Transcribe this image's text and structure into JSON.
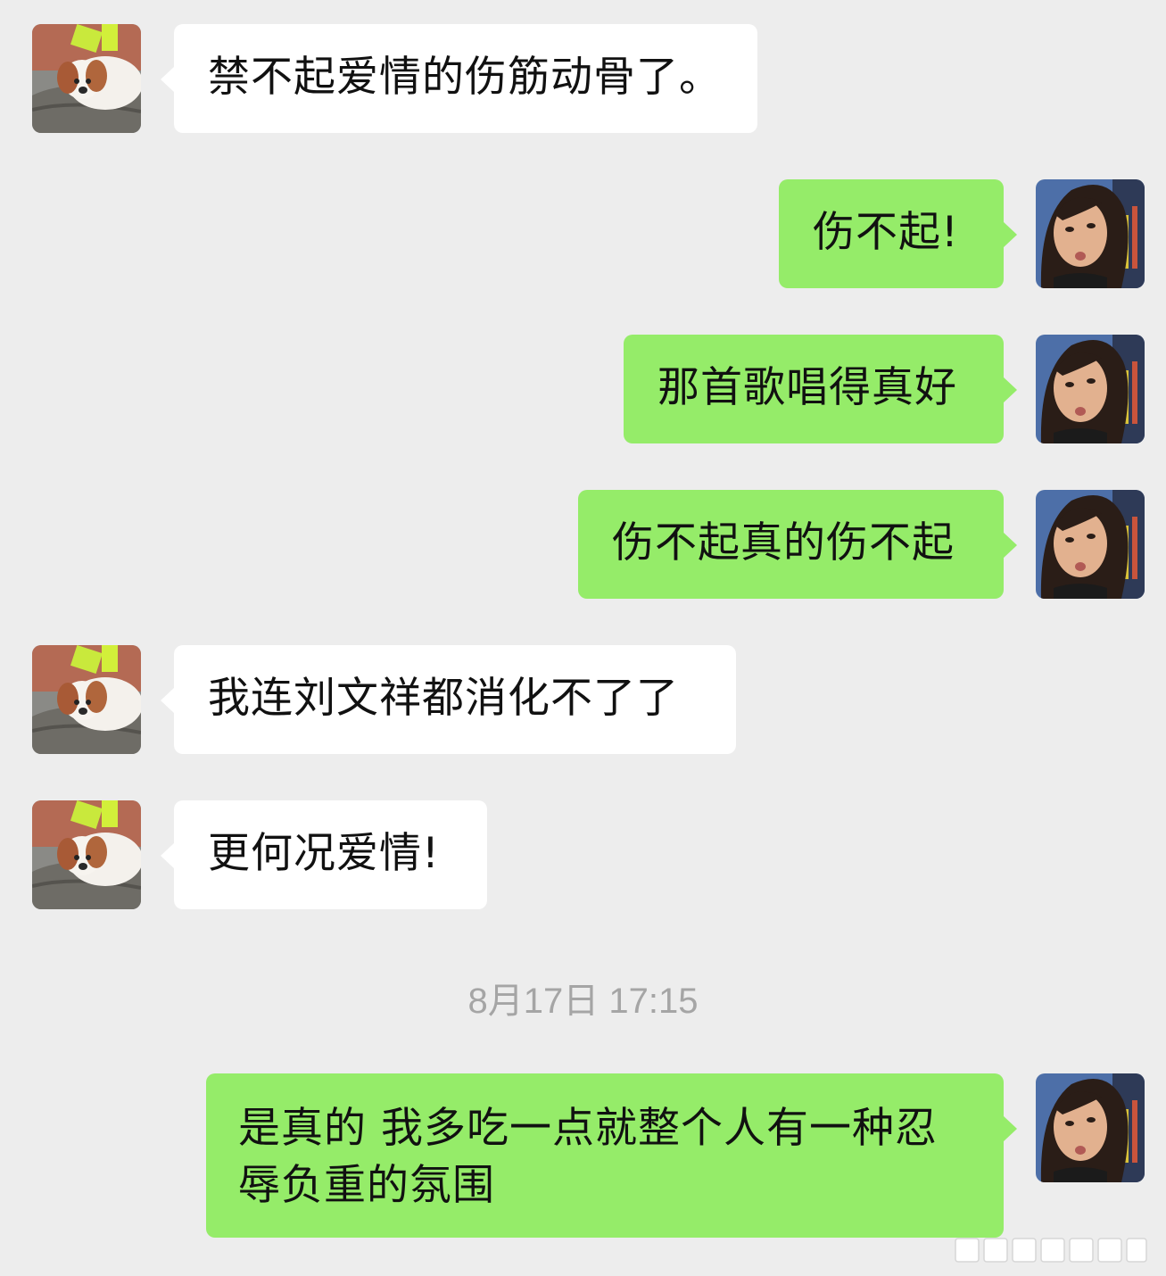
{
  "chat": {
    "messages": [
      {
        "side": "incoming",
        "avatar_icon": "puppy-avatar-icon",
        "text": "禁不起爱情的伤筋动骨了。"
      },
      {
        "side": "outgoing",
        "avatar_icon": "woman-avatar-icon",
        "text": "伤不起!"
      },
      {
        "side": "outgoing",
        "avatar_icon": "woman-avatar-icon",
        "text": "那首歌唱得真好"
      },
      {
        "side": "outgoing",
        "avatar_icon": "woman-avatar-icon",
        "text": "伤不起真的伤不起"
      },
      {
        "side": "incoming",
        "avatar_icon": "puppy-avatar-icon",
        "text": "我连刘文祥都消化不了了"
      },
      {
        "side": "incoming",
        "avatar_icon": "puppy-avatar-icon",
        "text": "更何况爱情!"
      },
      {
        "side": "outgoing",
        "avatar_icon": "woman-avatar-icon",
        "text": "是真的 我多吃一点就整个人有一种忍辱负重的氛围"
      }
    ],
    "timestamp": "8月17日 17:15"
  },
  "colors": {
    "background": "#ededed",
    "incoming_bubble": "#ffffff",
    "outgoing_bubble": "#95ec69",
    "timestamp_text": "#a5a5a5"
  }
}
